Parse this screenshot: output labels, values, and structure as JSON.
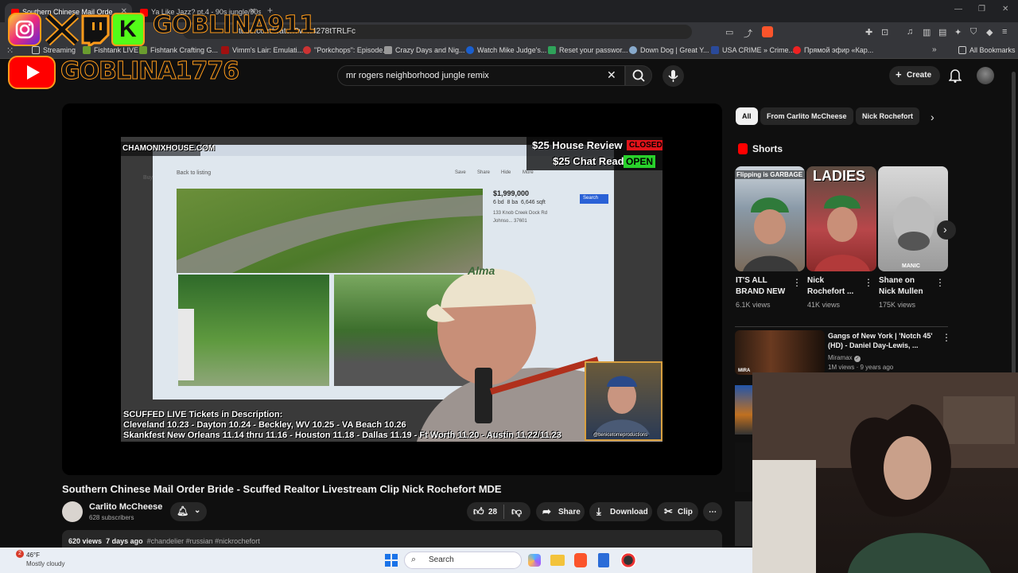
{
  "browser": {
    "tabs": [
      {
        "label": "Southern Chinese Mail Orde",
        "active": true
      },
      {
        "label": "Ya Like Jazz? pt.4 - 90s jungle/90s d",
        "active": false
      }
    ],
    "url": "tube.com/watch?v=n4278tTRLFc",
    "bookmarks": [
      {
        "label": "Streaming"
      },
      {
        "label": "Fishtank LIVE"
      },
      {
        "label": "Fishtank Crafting G..."
      },
      {
        "label": "Vimm's Lair: Emulati..."
      },
      {
        "label": "\"Porkchops\": Episode..."
      },
      {
        "label": "Crazy Days and Nig..."
      },
      {
        "label": "Watch Mike Judge's..."
      },
      {
        "label": "Reset your passwor..."
      },
      {
        "label": "Down Dog | Great Y..."
      },
      {
        "label": "USA CRIME » Crime..."
      },
      {
        "label": "Прямой эфир «Кар..."
      }
    ],
    "all_bookmarks": "All Bookmarks"
  },
  "youtube": {
    "search_value": "mr rogers neighborhood jungle remix",
    "create_label": "Create"
  },
  "stream_overlay": {
    "handle1": "GOBLINA911",
    "handle2": "GOBLINA1776"
  },
  "video_frame": {
    "site_label": "CHAMONIXHOUSE.COM",
    "house_review": "$25 House Review",
    "house_review_status": "CLOSED",
    "chat_read": "$25 Chat Read",
    "chat_read_status": "OPEN",
    "listing_back": "Back to listing",
    "listing_actions": [
      "Save",
      "Share",
      "Hide",
      "More"
    ],
    "price": "$1,999,000",
    "beds": "6 bd",
    "baths": "8 ba",
    "sqft": "6,646 sqft",
    "address": "133 Knob Creek Dock Rd",
    "address2": "Johnso... 37601",
    "search_tag": "Search",
    "buy_tag": "Buy",
    "hat_text": "Alma",
    "tickets_line1": "SCUFFED LIVE Tickets in Description:",
    "tickets_line2": "Cleveland 10.23 - Dayton 10.24 - Beckley, WV 10.25 - VA Beach 10.26",
    "tickets_line3": "Skankfest New Orleans 11.14 thru 11.16 - Houston 11.18 - Dallas 11.19 - Ft Worth 11.20 - Austin 11.22/11.23",
    "inset_handle": "@benicetomeproductions"
  },
  "video": {
    "title": "Southern Chinese Mail Order Bride - Scuffed Realtor Livestream Clip Nick Rochefort MDE",
    "channel": "Carlito McCheese",
    "subscribers": "628 subscribers",
    "likes": "28",
    "share": "Share",
    "download": "Download",
    "clip": "Clip",
    "views": "620 views",
    "age": "7 days ago",
    "tags": "#chandelier #russian #nickrochefort"
  },
  "sidebar": {
    "chips": [
      {
        "label": "All",
        "selected": true
      },
      {
        "label": "From Carlito McCheese",
        "selected": false
      },
      {
        "label": "Nick Rochefort",
        "selected": false
      }
    ],
    "shorts_heading": "Shorts",
    "shorts": [
      {
        "overlay": "Flipping is GARBAGE",
        "title": "IT'S ALL\nBRAND NEW",
        "views": "6.1K views"
      },
      {
        "overlay": "LADIES",
        "title": "Nick\nRochefort ...",
        "views": "41K views"
      },
      {
        "overlay": "MANIC",
        "title": "Shane on\nNick Mullen",
        "views": "175K views"
      }
    ],
    "rec_video": {
      "title": "Gangs of New York | 'Notch 45' (HD) - Daniel Day-Lewis, ...",
      "channel": "Miramax",
      "meta": "1M views · 9 years ago",
      "thumb_label": "MIRA"
    }
  },
  "taskbar": {
    "temp": "46°F",
    "weather": "Mostly cloudy",
    "badge": "2",
    "search_placeholder": "Search"
  },
  "colors": {
    "yt_bg": "#0f0f0f",
    "yt_red": "#ff0000",
    "overlay_orange": "#ff9b1a",
    "green_status": "#29d12b",
    "red_status": "#e0141a"
  }
}
